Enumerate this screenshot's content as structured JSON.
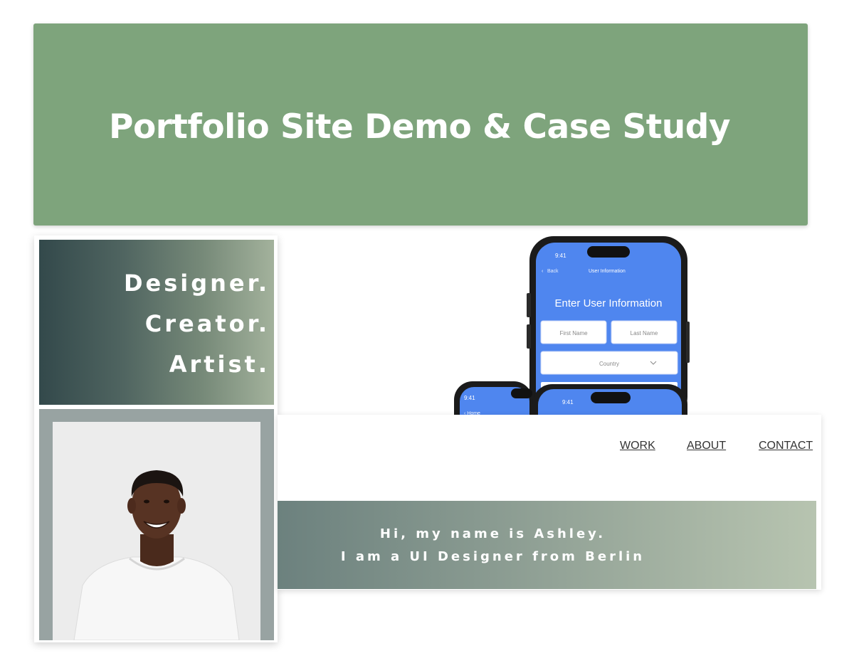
{
  "banner": {
    "title": "Portfolio Site Demo & Case Study",
    "color": "#7ea47c"
  },
  "tagline": {
    "lines": [
      "Designer.",
      "Creator.",
      "Artist."
    ]
  },
  "profile_photo": {
    "description_icon": "person-photo"
  },
  "phone": {
    "time": "9:41",
    "back_label": "Back",
    "screen_title": "User Information",
    "heading": "Enter User Information",
    "first_name_placeholder": "First Name",
    "last_name_placeholder": "Last Name",
    "country_placeholder": "Country",
    "accent": "#4f86ef"
  },
  "site": {
    "nav": {
      "work": "WORK",
      "about": "ABOUT",
      "contact": "CONTACT"
    },
    "intro": {
      "line1": "Hi, my name is Ashley.",
      "line2": "I am a UI Designer from Berlin"
    }
  }
}
